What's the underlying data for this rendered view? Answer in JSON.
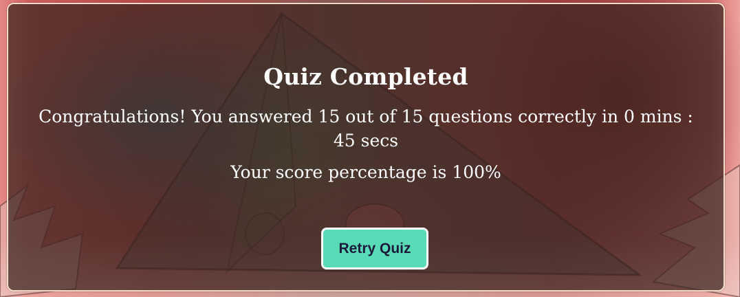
{
  "quiz": {
    "title": "Quiz Completed",
    "message": "Congratulations! You answered 15 out of 15 questions correctly in 0 mins : 45 secs",
    "score_text": "Your score percentage is 100%",
    "retry_label": "Retry Quiz"
  },
  "colors": {
    "button_background": "#59dbb8",
    "button_text": "#1b1a3a",
    "panel_overlay": "#3a241e",
    "text": "#ffffff"
  }
}
